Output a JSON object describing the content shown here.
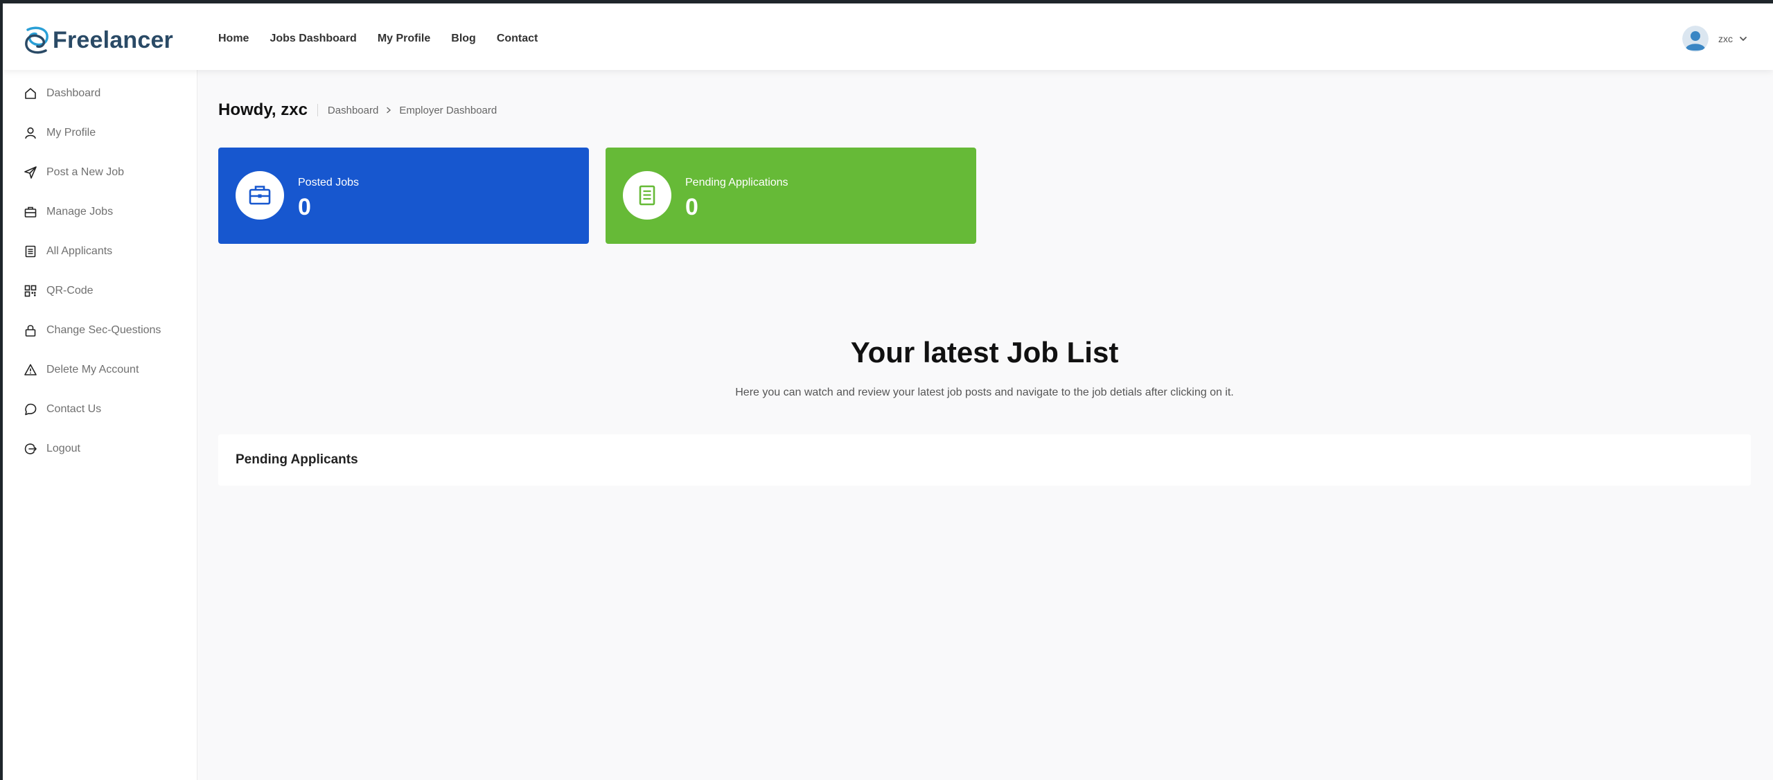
{
  "brand": {
    "name": "Freelancer"
  },
  "nav": {
    "items": [
      "Home",
      "Jobs Dashboard",
      "My Profile",
      "Blog",
      "Contact"
    ]
  },
  "user": {
    "name": "zxc"
  },
  "sidebar": {
    "items": [
      {
        "label": "Dashboard",
        "icon": "home-icon"
      },
      {
        "label": "My Profile",
        "icon": "user-icon"
      },
      {
        "label": "Post a New Job",
        "icon": "send-icon"
      },
      {
        "label": "Manage Jobs",
        "icon": "briefcase-icon"
      },
      {
        "label": "All Applicants",
        "icon": "document-icon"
      },
      {
        "label": "QR-Code",
        "icon": "qr-code-icon"
      },
      {
        "label": "Change Sec-Questions",
        "icon": "lock-icon"
      },
      {
        "label": "Delete My Account",
        "icon": "warning-icon"
      },
      {
        "label": "Contact Us",
        "icon": "chat-icon"
      },
      {
        "label": "Logout",
        "icon": "logout-icon"
      }
    ]
  },
  "header": {
    "greeting": "Howdy, zxc",
    "breadcrumb": [
      "Dashboard",
      "Employer Dashboard"
    ]
  },
  "stats": [
    {
      "label": "Posted Jobs",
      "value": "0",
      "color": "#1757cf",
      "icon": "briefcase-icon"
    },
    {
      "label": "Pending Applications",
      "value": "0",
      "color": "#66ba37",
      "icon": "document-icon"
    }
  ],
  "latest": {
    "title": "Your latest Job List",
    "subtitle": "Here you can watch and review your latest job posts and navigate to the job detials after clicking on it."
  },
  "panel": {
    "title": "Pending Applicants"
  }
}
